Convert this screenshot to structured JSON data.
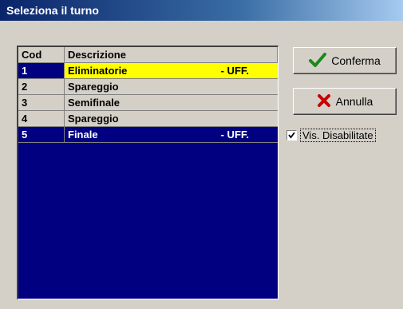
{
  "window": {
    "title": "Seleziona il turno"
  },
  "table": {
    "headers": [
      "Cod",
      "Descrizione"
    ],
    "rows": [
      {
        "cod": "1",
        "descr": "Eliminatorie",
        "tag": "- UFF."
      },
      {
        "cod": "2",
        "descr": "Spareggio",
        "tag": ""
      },
      {
        "cod": "3",
        "descr": "Semifinale",
        "tag": ""
      },
      {
        "cod": "4",
        "descr": "Spareggio",
        "tag": ""
      },
      {
        "cod": "5",
        "descr": "Finale",
        "tag": "- UFF."
      }
    ]
  },
  "buttons": {
    "confirm": {
      "label": "Conferma",
      "icon": "check-icon"
    },
    "cancel": {
      "label": "Annulla",
      "icon": "x-icon"
    }
  },
  "checkbox": {
    "label": "Vis. Disabilitate",
    "checked": true
  },
  "colors": {
    "selected_row": "#ffff00",
    "grid_bg": "#000080",
    "title_bar": "#0a246a"
  }
}
